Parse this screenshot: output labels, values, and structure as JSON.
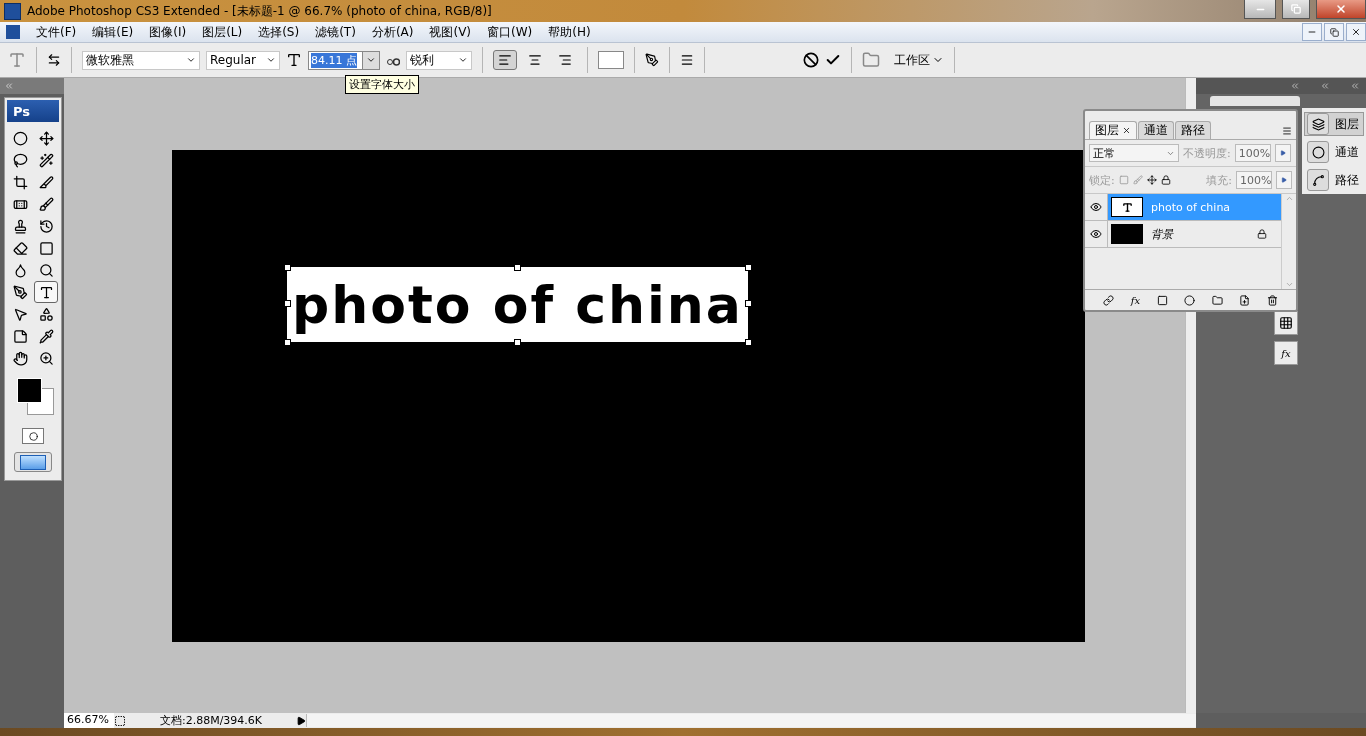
{
  "window": {
    "title": "Adobe Photoshop CS3 Extended - [未标题-1 @ 66.7% (photo of china, RGB/8)]"
  },
  "menu": [
    "文件(F)",
    "编辑(E)",
    "图像(I)",
    "图层(L)",
    "选择(S)",
    "滤镜(T)",
    "分析(A)",
    "视图(V)",
    "窗口(W)",
    "帮助(H)"
  ],
  "options_bar": {
    "font_family": "微软雅黑",
    "font_style": "Regular",
    "font_size": "84.11 点",
    "font_size_tooltip": "设置字体大小",
    "antialias": "锐利",
    "align": [
      {
        "kind": "left",
        "selected": true
      },
      {
        "kind": "center",
        "selected": false
      },
      {
        "kind": "right",
        "selected": false
      }
    ],
    "workspace": "工作区"
  },
  "tools": [
    {
      "kind": "marquee",
      "selected": false
    },
    {
      "kind": "move",
      "selected": false
    },
    {
      "kind": "lasso",
      "selected": false
    },
    {
      "kind": "wand",
      "selected": false
    },
    {
      "kind": "crop",
      "selected": false
    },
    {
      "kind": "slice",
      "selected": false
    },
    {
      "kind": "heal",
      "selected": false
    },
    {
      "kind": "brush",
      "selected": false
    },
    {
      "kind": "stamp",
      "selected": false
    },
    {
      "kind": "history",
      "selected": false
    },
    {
      "kind": "eraser",
      "selected": false
    },
    {
      "kind": "gradient",
      "selected": false
    },
    {
      "kind": "blur",
      "selected": false
    },
    {
      "kind": "dodge",
      "selected": false
    },
    {
      "kind": "pen",
      "selected": false
    },
    {
      "kind": "type",
      "selected": true
    },
    {
      "kind": "select",
      "selected": false
    },
    {
      "kind": "shape",
      "selected": false
    },
    {
      "kind": "notes",
      "selected": false
    },
    {
      "kind": "eyedropper",
      "selected": false
    },
    {
      "kind": "hand",
      "selected": false
    },
    {
      "kind": "zoom",
      "selected": false
    }
  ],
  "tools_logo": "Ps",
  "canvas": {
    "text": "photo of china"
  },
  "fx_button": "fx",
  "layers_panel": {
    "tabs": [
      {
        "label": "图层",
        "selected": true
      },
      {
        "label": "通道",
        "selected": false
      },
      {
        "label": "路径",
        "selected": false
      }
    ],
    "blend_mode": "正常",
    "footer_fx": "fx",
    "opacity_label": "不透明度:",
    "opacity": "100%",
    "lock_label": "锁定:",
    "fill_label": "填充:",
    "fill": "100%",
    "layers": [
      {
        "name": "photo of china",
        "kind": "text",
        "selected": true,
        "visible": true,
        "locked": false
      },
      {
        "name": "背景",
        "kind": "fill",
        "selected": false,
        "visible": true,
        "locked": true
      }
    ]
  },
  "dock": [
    {
      "label": "图层",
      "kind": "layers",
      "selected": true
    },
    {
      "label": "通道",
      "kind": "channels",
      "selected": false
    },
    {
      "label": "路径",
      "kind": "paths",
      "selected": false
    }
  ],
  "status_bar": {
    "zoom": "66.67%",
    "doc_info": "文档:2.88M/394.6K"
  }
}
